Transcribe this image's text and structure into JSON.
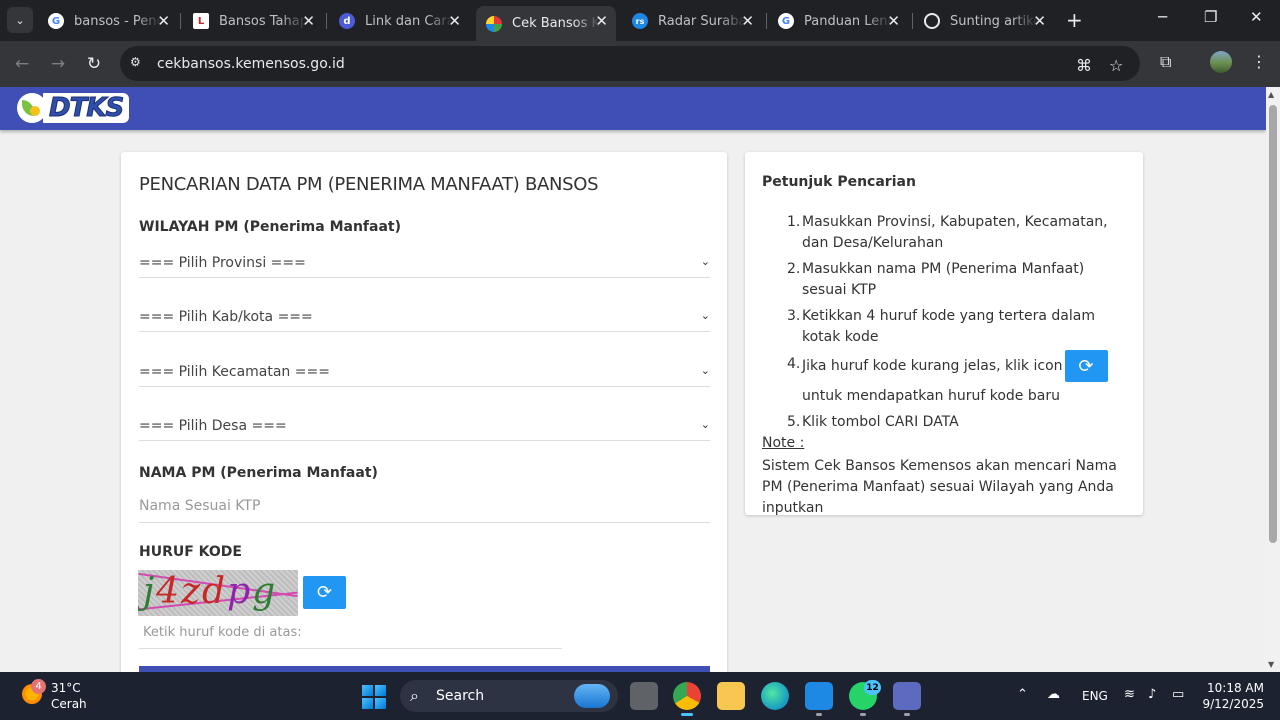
{
  "browser": {
    "tabs": [
      {
        "title": "bansos - Pene",
        "favicon": "google-icon",
        "color": "#ffffff"
      },
      {
        "title": "Bansos Tahap",
        "favicon": "news-icon",
        "color": "#ffffff"
      },
      {
        "title": "Link dan Cara",
        "favicon": "d-icon",
        "color": "#4d5bd6"
      },
      {
        "title": "Cek Bansos Ke",
        "favicon": "kemensos-icon",
        "color": "#e8eaed"
      },
      {
        "title": "Radar Surabay",
        "favicon": "rs-icon",
        "color": "#1e88e5"
      },
      {
        "title": "Panduan Leng",
        "favicon": "google-icon",
        "color": "#ffffff"
      },
      {
        "title": "Sunting artike",
        "favicon": "chatgpt-icon",
        "color": "#e8eaed"
      }
    ],
    "active_tab": 3,
    "url": "cekbansos.kemensos.go.id"
  },
  "site": {
    "logo_text": "DTKS"
  },
  "form": {
    "title": "PENCARIAN DATA PM (PENERIMA MANFAAT) BANSOS",
    "wilayah_label": "WILAYAH PM (Penerima Manfaat)",
    "provinsi": "=== Pilih Provinsi ===",
    "kabkota": "=== Pilih Kab/kota ===",
    "kecamatan": "=== Pilih Kecamatan ===",
    "desa": "=== Pilih Desa ===",
    "nama_label": "NAMA PM (Penerima Manfaat)",
    "nama_placeholder": "Nama Sesuai KTP",
    "kode_label": "HURUF KODE",
    "captcha_text": "j4zdpg",
    "kode_placeholder": "Ketik huruf kode di atas:"
  },
  "help": {
    "title": "Petunjuk Pencarian",
    "steps": [
      "Masukkan Provinsi, Kabupaten, Kecamatan, dan Desa/Kelurahan",
      "Masukkan nama PM (Penerima Manfaat) sesuai KTP",
      "Ketikkan 4 huruf kode yang tertera dalam kotak kode",
      {
        "before": "Jika huruf kode kurang jelas, klik icon",
        "after": "untuk mendapatkan huruf kode baru"
      },
      "Klik tombol CARI DATA"
    ],
    "note_label": "Note :",
    "note_text": "Sistem Cek Bansos Kemensos akan mencari Nama PM (Penerima Manfaat) sesuai Wilayah yang Anda inputkan"
  },
  "taskbar": {
    "weather_badge": "4",
    "temperature": "31°C",
    "condition": "Cerah",
    "search_label": "Search",
    "whatsapp_badge": "12",
    "language": "ENG",
    "time": "10:18 AM",
    "date": "9/12/2025"
  },
  "colors": {
    "brand_blue": "#3f4fb5",
    "refresh_blue": "#2196f3"
  }
}
